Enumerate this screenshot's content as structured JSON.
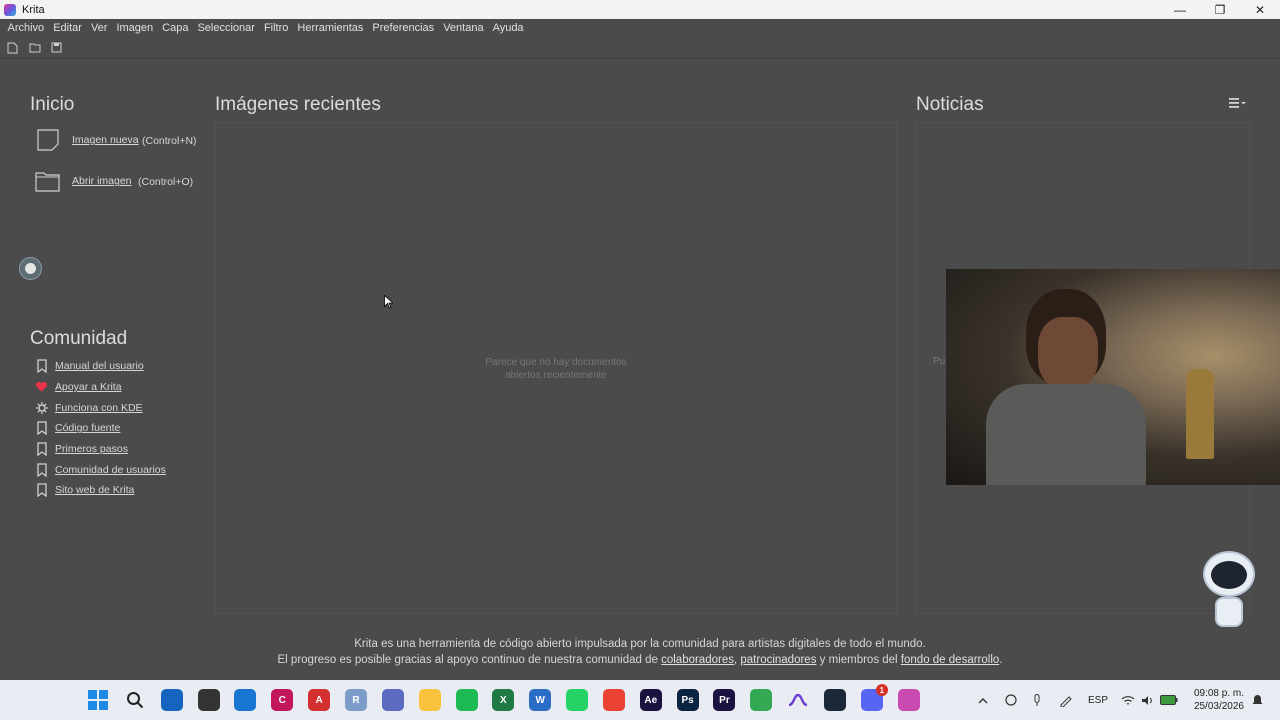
{
  "window": {
    "title": "Krita",
    "minimize": "—",
    "maximize": "❐",
    "close": "✕"
  },
  "menu": [
    "Archivo",
    "Editar",
    "Ver",
    "Imagen",
    "Capa",
    "Seleccionar",
    "Filtro",
    "Herramientas",
    "Preferencias",
    "Ventana",
    "Ayuda"
  ],
  "start": {
    "heading": "Inicio",
    "new_image": {
      "label": "Imagen nueva",
      "shortcut": "(Control+N)"
    },
    "open_image": {
      "label": "Abrir imagen",
      "shortcut": "(Control+O)"
    }
  },
  "recent": {
    "heading": "Imágenes recientes",
    "empty_line1": "Parece que no hay documentos",
    "empty_line2": "abiertos recientemente"
  },
  "news": {
    "heading": "Noticias",
    "partial_text": "Pu"
  },
  "community": {
    "heading": "Comunidad",
    "items": [
      {
        "label": "Manual del usuario",
        "icon": "bookmark-icon"
      },
      {
        "label": "Apoyar a Krita",
        "icon": "heart-icon"
      },
      {
        "label": "Funciona con KDE",
        "icon": "kde-icon"
      },
      {
        "label": "Código fuente",
        "icon": "bookmark-icon"
      },
      {
        "label": "Primeros pasos",
        "icon": "bookmark-icon"
      },
      {
        "label": "Comunidad de usuarios",
        "icon": "bookmark-icon"
      },
      {
        "label": "Sito web de Krita",
        "icon": "bookmark-icon"
      }
    ]
  },
  "footer": {
    "line1": "Krita es una herramienta de código abierto impulsada por la comunidad para artistas digitales de todo el mundo.",
    "line2_a": "El progreso es posible gracias al apoyo continuo de nuestra comunidad de ",
    "link_collaborators": "colaboradores",
    "sep1": ", ",
    "link_sponsors": "patrocinadores",
    "line2_b": " y miembros del ",
    "link_dev_fund": "fondo de desarrollo",
    "line2_end": "."
  },
  "taskbar": {
    "apps": [
      {
        "name": "start-icon",
        "color": "#1e88e5",
        "text": ""
      },
      {
        "name": "search-icon",
        "color": "#e9edf3",
        "text": ""
      },
      {
        "name": "store-icon",
        "color": "#1565c0",
        "text": ""
      },
      {
        "name": "unity-icon",
        "color": "#333333",
        "text": ""
      },
      {
        "name": "autocad-icon",
        "color": "#1976d2",
        "text": ""
      },
      {
        "name": "civil3d-icon",
        "color": "#c2185b",
        "text": "C"
      },
      {
        "name": "autocad-red-icon",
        "color": "#d32f2f",
        "text": "A"
      },
      {
        "name": "r-icon",
        "color": "#7e9cc9",
        "text": "R"
      },
      {
        "name": "teams-icon",
        "color": "#5c6bc0",
        "text": ""
      },
      {
        "name": "files-icon",
        "color": "#f9c23c",
        "text": ""
      },
      {
        "name": "spotify-icon",
        "color": "#1db954",
        "text": ""
      },
      {
        "name": "excel-icon",
        "color": "#1f7a45",
        "text": "X"
      },
      {
        "name": "word-icon",
        "color": "#2b6cc4",
        "text": "W"
      },
      {
        "name": "whatsapp-icon",
        "color": "#25d366",
        "text": ""
      },
      {
        "name": "chrome-icon",
        "color": "#ea4335",
        "text": ""
      },
      {
        "name": "after-effects-icon",
        "color": "#1a1340",
        "text": "Ae"
      },
      {
        "name": "photoshop-icon",
        "color": "#0b2540",
        "text": "Ps"
      },
      {
        "name": "premiere-icon",
        "color": "#1a1340",
        "text": "Pr"
      },
      {
        "name": "chrome-alt-icon",
        "color": "#34a853",
        "text": ""
      },
      {
        "name": "curve-app-icon",
        "color": "#e9edf3",
        "text": ""
      },
      {
        "name": "steam-icon",
        "color": "#1b2838",
        "text": ""
      },
      {
        "name": "discord-icon",
        "color": "#5865f2",
        "text": ""
      },
      {
        "name": "krita-icon",
        "color": "#c94ab0",
        "text": ""
      }
    ],
    "discord_badge": "1",
    "lang": "ESP",
    "time": "09:08 p. m.",
    "date": "25/03/2026"
  }
}
